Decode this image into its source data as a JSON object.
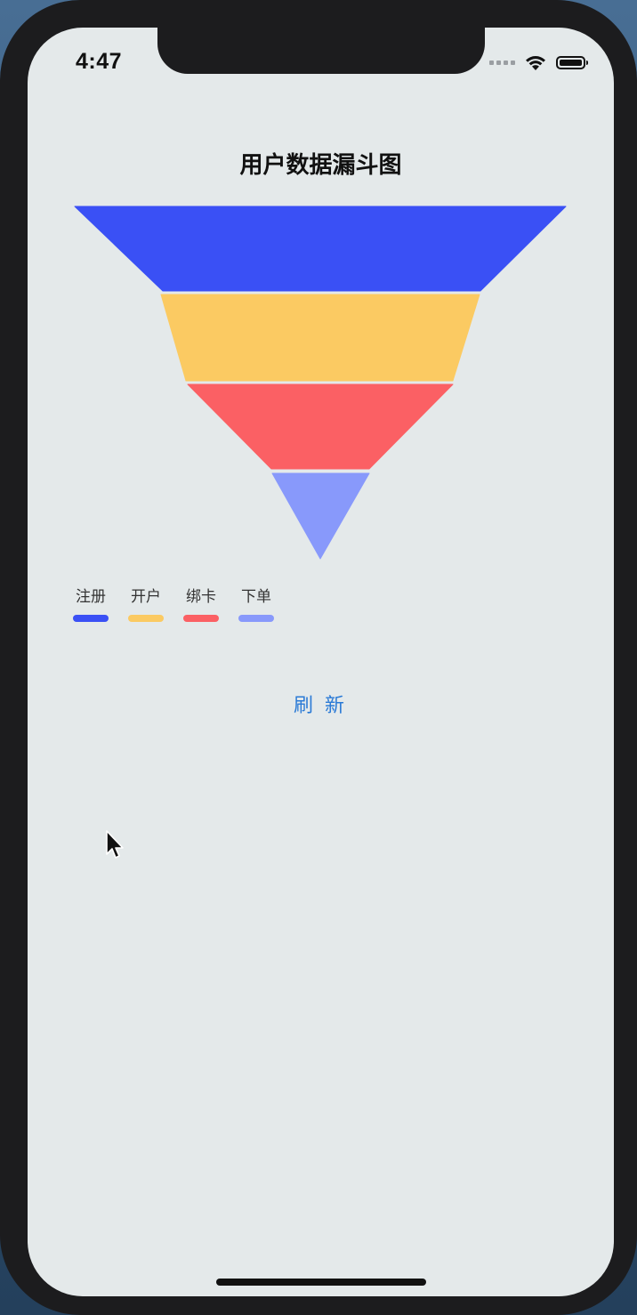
{
  "status_bar": {
    "time": "4:47",
    "icons": [
      "signal-dots-icon",
      "wifi-icon",
      "battery-icon"
    ]
  },
  "chart_data": {
    "type": "funnel",
    "title": "用户数据漏斗图",
    "stages": [
      {
        "name": "注册",
        "color": "#3a50f5"
      },
      {
        "name": "开户",
        "color": "#fbca62"
      },
      {
        "name": "绑卡",
        "color": "#fb6064"
      },
      {
        "name": "下单",
        "color": "#8899fb"
      }
    ],
    "legend_position": "bottom-left"
  },
  "actions": {
    "refresh_label": "刷 新"
  },
  "colors": {
    "background": "#e4e9ea",
    "accent": "#2a7ad6"
  }
}
